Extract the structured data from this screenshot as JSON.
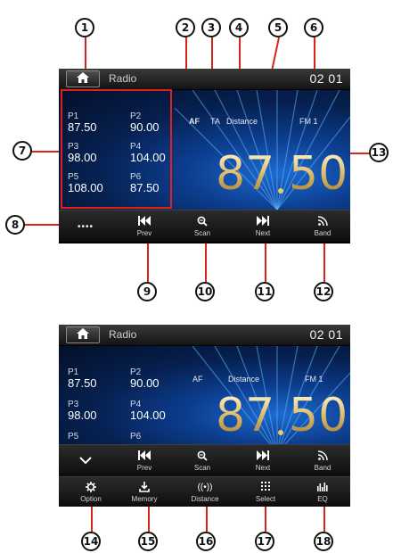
{
  "callouts": [
    "1",
    "2",
    "3",
    "4",
    "5",
    "6",
    "7",
    "8",
    "9",
    "10",
    "11",
    "12",
    "13",
    "14",
    "15",
    "16",
    "17",
    "18"
  ],
  "screen1": {
    "title": "Radio",
    "clock": "02 01",
    "presets": [
      {
        "label": "P1",
        "value": "87.50"
      },
      {
        "label": "P2",
        "value": "90.00"
      },
      {
        "label": "P3",
        "value": "98.00"
      },
      {
        "label": "P4",
        "value": "104.00"
      },
      {
        "label": "P5",
        "value": "108.00"
      },
      {
        "label": "P6",
        "value": "87.50"
      }
    ],
    "af": "AF",
    "ta": "TA",
    "distance": "Distance",
    "band_indicator": "FM 1",
    "freq_left": "87",
    "freq_right": "50",
    "more": "••••",
    "buttons": {
      "prev": "Prev",
      "scan": "Scan",
      "next": "Next",
      "band": "Band"
    }
  },
  "screen2": {
    "title": "Radio",
    "clock": "02 01",
    "presets": [
      {
        "label": "P1",
        "value": "87.50"
      },
      {
        "label": "P2",
        "value": "90.00"
      },
      {
        "label": "P3",
        "value": "98.00"
      },
      {
        "label": "P4",
        "value": "104.00"
      },
      {
        "label": "P5",
        "value": ""
      },
      {
        "label": "P6",
        "value": ""
      }
    ],
    "af": "AF",
    "distance": "Distance",
    "band_indicator": "FM 1",
    "freq_left": "87",
    "freq_right": "50",
    "buttons": {
      "prev": "Prev",
      "scan": "Scan",
      "next": "Next",
      "band": "Band"
    },
    "buttons2": {
      "option": "Option",
      "memory": "Memory",
      "distance": "Distance",
      "select": "Select",
      "eq": "EQ"
    }
  },
  "icons": {
    "home": "home-icon",
    "prev": "skip-back-icon",
    "scan": "zoom-icon",
    "next": "skip-forward-icon",
    "band": "signal-icon",
    "collapse": "chevron-down-icon",
    "option": "gear-icon",
    "memory": "download-icon",
    "distance": "antenna-icon",
    "select": "grid-icon",
    "eq": "equalizer-icon"
  },
  "colors": {
    "accent_red": "#e0201a",
    "frequency_gold": "#e3c173",
    "screen_blue": "#0c3d8e"
  }
}
